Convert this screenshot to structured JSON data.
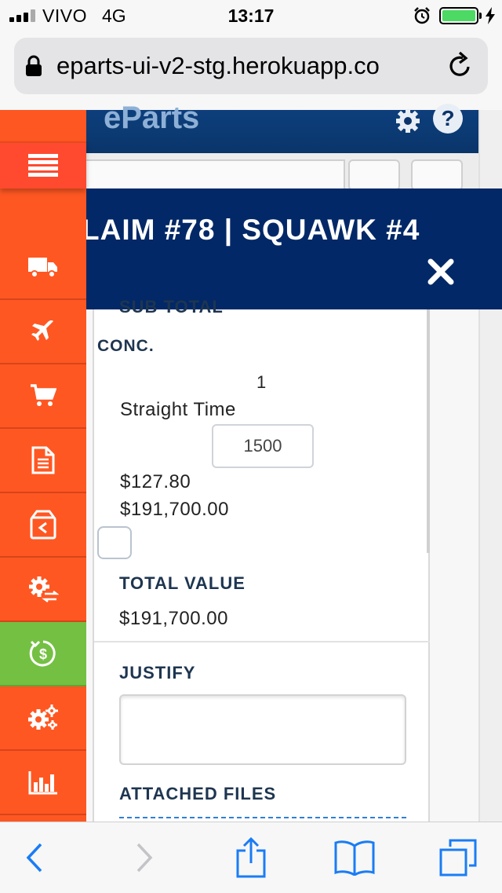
{
  "status_bar": {
    "carrier": "VIVO",
    "network": "4G",
    "time": "13:17",
    "battery_level": 0.9
  },
  "browser": {
    "url": "eparts-ui-v2-stg.herokuapp.co"
  },
  "app": {
    "logo": "eParts"
  },
  "sidebar": {
    "items": [
      {
        "icon": "menu-icon"
      },
      {
        "icon": "truck-icon"
      },
      {
        "icon": "airplane-icon"
      },
      {
        "icon": "cart-icon"
      },
      {
        "icon": "document-icon"
      },
      {
        "icon": "return-box-icon"
      },
      {
        "icon": "gear-exchange-icon"
      },
      {
        "icon": "refund-dollar-icon",
        "active": true
      },
      {
        "icon": "settings-icon"
      },
      {
        "icon": "bar-chart-icon"
      }
    ]
  },
  "modal": {
    "title": "LAIM #78 | SQUAWK #4",
    "subtotal_heading": "SUB TOTAL",
    "conc_label": "CONC.",
    "quantity": "1",
    "labor_type": "Straight Time",
    "hours_value": "1500",
    "rate": "$127.80",
    "line_subtotal": "$191,700.00",
    "total_value_label": "TOTAL VALUE",
    "total_value": "$191,700.00",
    "justify_label": "JUSTIFY",
    "justify_value": "",
    "attached_files_label": "ATTACHED FILES"
  },
  "colors": {
    "sidebar": "#ff5722",
    "sidebar_active": "#74c043",
    "modal_header": "#022867",
    "heading_text": "#1e3550"
  }
}
